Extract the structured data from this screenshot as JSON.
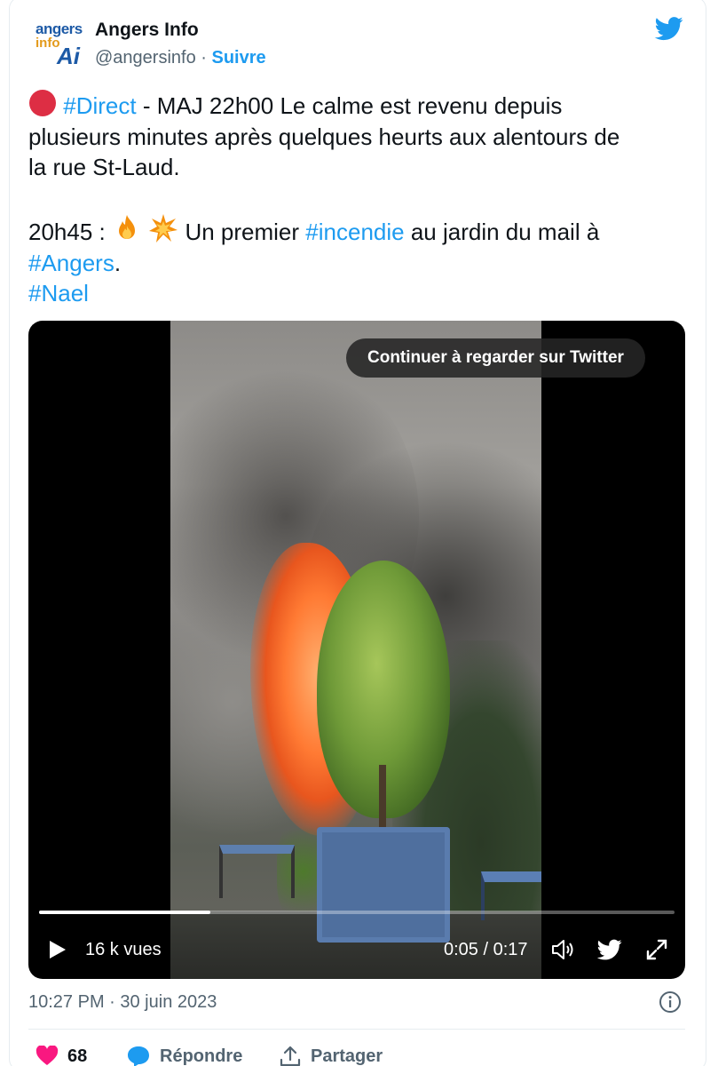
{
  "author": {
    "name": "Angers Info",
    "handle": "@angersinfo",
    "separator": "·",
    "follow_label": "Suivre",
    "avatar_logo_text": [
      "angers",
      "info",
      "Ai"
    ]
  },
  "tweet": {
    "line1_prefix_icon": "red-circle-emoji",
    "line1_hashtag": "#Direct",
    "line1_text": " - MAJ 22h00 Le calme est revenu depuis",
    "line2": "plusieurs minutes après quelques heurts aux alentours de",
    "line3": "la rue St-Laud.",
    "line4_prefix": "20h45 : ",
    "line4_emojis": [
      "fire-emoji",
      "collision-emoji"
    ],
    "line4_mid": " Un premier ",
    "line4_hashtag": "#incendie",
    "line4_suffix": " au jardin du mail à",
    "line5_hashtag": "#Angers",
    "line5_suffix": ".",
    "line6_hashtag": "#Nael"
  },
  "video": {
    "overlay_pill": "Continuer à regarder sur Twitter",
    "views": "16 k vues",
    "time": "0:05 / 0:17",
    "progress": 0.27
  },
  "footer": {
    "timestamp": "10:27 PM · 30 juin 2023",
    "likes_count": "68",
    "reply_label": "Répondre",
    "share_label": "Partager"
  },
  "colors": {
    "accent": "#1d9bf0",
    "like": "#f91880",
    "text": "#0f1419",
    "muted": "#536471"
  }
}
